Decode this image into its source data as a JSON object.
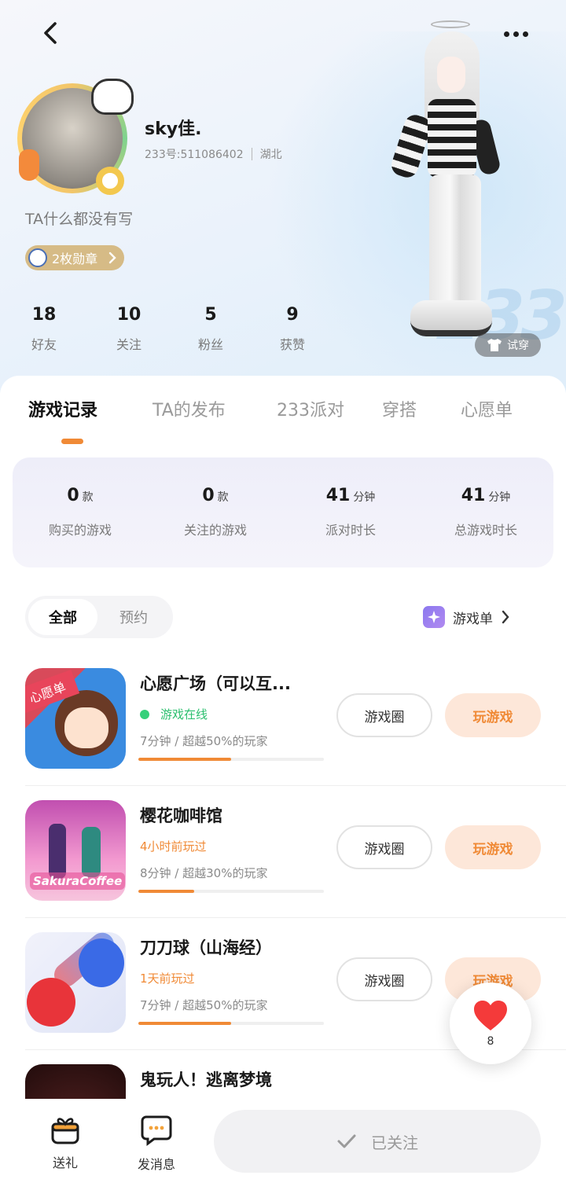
{
  "profile": {
    "username": "sky佳.",
    "id_text": "233号:511086402",
    "location": "湖北",
    "bio": "TA什么都没有写",
    "badge_label": "2枚勋章",
    "try_on_label": "试穿"
  },
  "stats": [
    {
      "value": "18",
      "label": "好友"
    },
    {
      "value": "10",
      "label": "关注"
    },
    {
      "value": "5",
      "label": "粉丝"
    },
    {
      "value": "9",
      "label": "获赞"
    }
  ],
  "tabs": [
    "游戏记录",
    "TA的发布",
    "233派对",
    "穿搭",
    "心愿单"
  ],
  "summary": [
    {
      "value": "0",
      "unit": "款",
      "label": "购买的游戏"
    },
    {
      "value": "0",
      "unit": "款",
      "label": "关注的游戏"
    },
    {
      "value": "41",
      "unit": "分钟",
      "label": "派对时长"
    },
    {
      "value": "41",
      "unit": "分钟",
      "label": "总游戏时长"
    }
  ],
  "filter": {
    "all": "全部",
    "reserve": "预约"
  },
  "game_list_link": "游戏单",
  "games": [
    {
      "title": "心愿广场（可以互...",
      "status": "游戏在线",
      "status_color": "#2bbf6e",
      "meta": "7分钟 / 超越50%的玩家",
      "progress": 0.5,
      "circle_label": "游戏圈",
      "play_label": "玩游戏",
      "thumb_tag": "心愿单"
    },
    {
      "title": "樱花咖啡馆",
      "status": "4小时前玩过",
      "status_color": "#f08a36",
      "meta": "8分钟 / 超越30%的玩家",
      "progress": 0.3,
      "circle_label": "游戏圈",
      "play_label": "玩游戏",
      "thumb_tag": "SakuraCoffee"
    },
    {
      "title": "刀刀球（山海经）",
      "status": "1天前玩过",
      "status_color": "#f08a36",
      "meta": "7分钟 / 超越50%的玩家",
      "progress": 0.5,
      "circle_label": "游戏圈",
      "play_label": "玩游戏"
    },
    {
      "title": "鬼玩人！逃离梦境"
    }
  ],
  "like": {
    "count": "8"
  },
  "bottom": {
    "gift": "送礼",
    "message": "发消息",
    "follow": "已关注"
  },
  "colors": {
    "accent": "#f08a36",
    "online": "#36d07a"
  }
}
